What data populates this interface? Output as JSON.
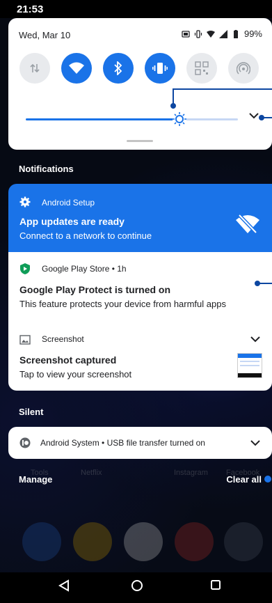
{
  "status_bar": {
    "time": "21:53"
  },
  "quick_settings": {
    "date": "Wed, Mar 10",
    "battery": "99%",
    "tiles": [
      {
        "name": "data",
        "state": "off"
      },
      {
        "name": "wifi",
        "state": "on"
      },
      {
        "name": "bluetooth",
        "state": "on"
      },
      {
        "name": "vibrate",
        "state": "on"
      },
      {
        "name": "qr",
        "state": "off"
      },
      {
        "name": "hotspot",
        "state": "off"
      }
    ],
    "brightness_level": 0.72
  },
  "notifications_header": "Notifications",
  "notifications": [
    {
      "app": "Android Setup",
      "title": "App updates are ready",
      "subtitle": "Connect to a network to continue"
    },
    {
      "app": "Google Play Store • 1h",
      "title": "Google Play Protect is turned on",
      "subtitle": "This feature protects your device from harmful apps"
    },
    {
      "app": "Screenshot",
      "title": "Screenshot captured",
      "subtitle": "Tap to view your screenshot"
    }
  ],
  "silent_header": "Silent",
  "silent": {
    "text": "Android System • USB file transfer turned on"
  },
  "home_labels": [
    "Tools",
    "Netflix",
    "Instagram",
    "Facebook"
  ],
  "footer": {
    "manage": "Manage",
    "clear_all": "Clear all"
  },
  "colors": {
    "accent": "#1a73e8"
  }
}
